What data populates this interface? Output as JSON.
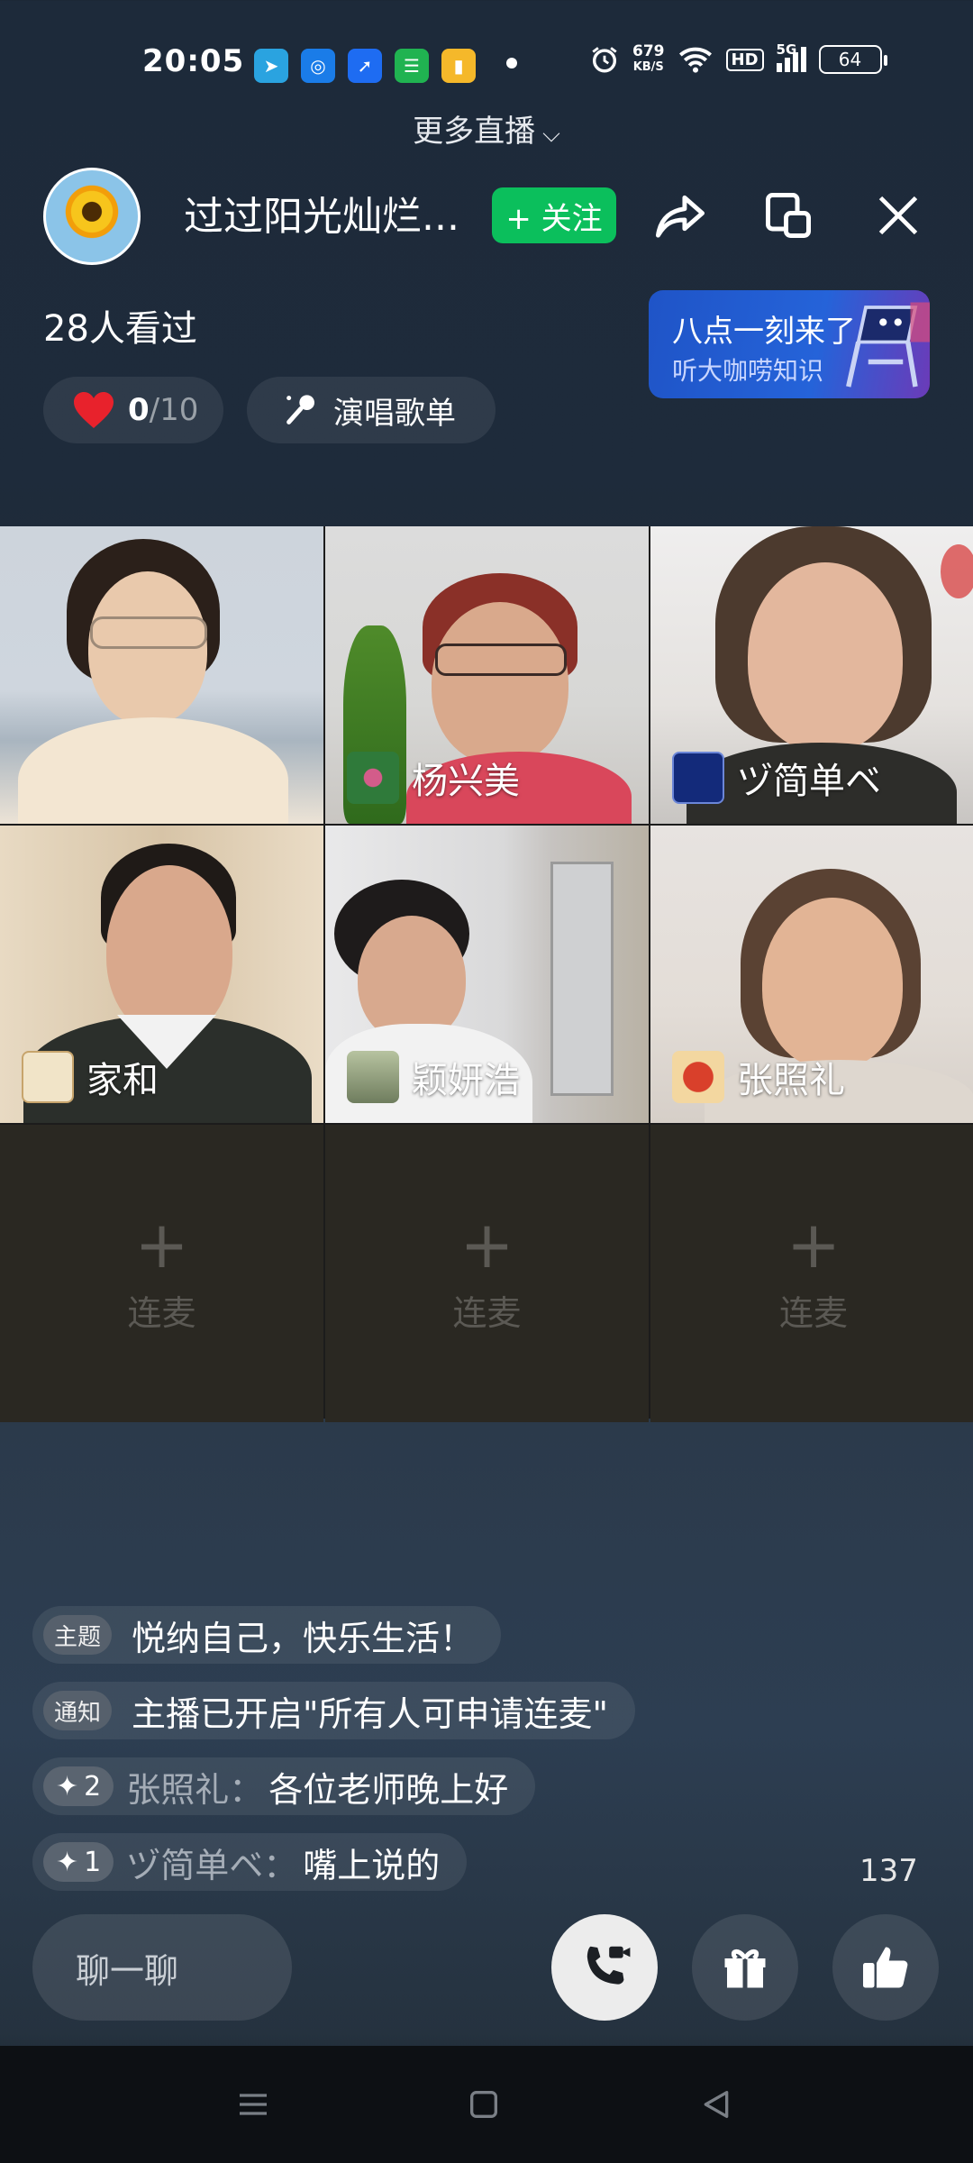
{
  "status": {
    "time": "20:05",
    "net_speed_value": "679",
    "net_speed_unit": "KB/S",
    "hd": "HD",
    "signal": "5G",
    "battery": "64",
    "app_icons": [
      "telegram-icon",
      "browser-icon",
      "maps-icon",
      "messages-icon",
      "books-icon"
    ]
  },
  "header": {
    "more_live": "更多直播",
    "host_name": "过过阳光灿烂...",
    "follow": "+ 关注",
    "watched": "28人看过",
    "hearts_current": "0",
    "hearts_total": "/10",
    "songlist": "演唱歌单",
    "promo_title": "八点一刻来了",
    "promo_sub": "听大咖唠知识"
  },
  "seats": [
    {
      "name": ""
    },
    {
      "name": "杨兴美"
    },
    {
      "name": "ヅ简单ベ"
    },
    {
      "name": "家和"
    },
    {
      "name": "颖妍浩"
    },
    {
      "name": "张照礼"
    }
  ],
  "empty_seats": [
    {
      "label": "连麦"
    },
    {
      "label": "连麦"
    },
    {
      "label": "连麦"
    }
  ],
  "comments": [
    {
      "tag": "主题",
      "text": "悦纳自己，快乐生活！"
    },
    {
      "tag": "通知",
      "text": "主播已开启\"所有人可申请连麦\""
    },
    {
      "level": "2",
      "user": "张照礼：",
      "text": "各位老师晚上好"
    },
    {
      "level": "1",
      "user": "ヅ简单ベ：",
      "text": "嘴上说的"
    }
  ],
  "footer": {
    "like_count": "137",
    "chat_placeholder": "聊一聊"
  },
  "colors": {
    "follow": "#0bbf5c",
    "promo": "#2563d9"
  }
}
